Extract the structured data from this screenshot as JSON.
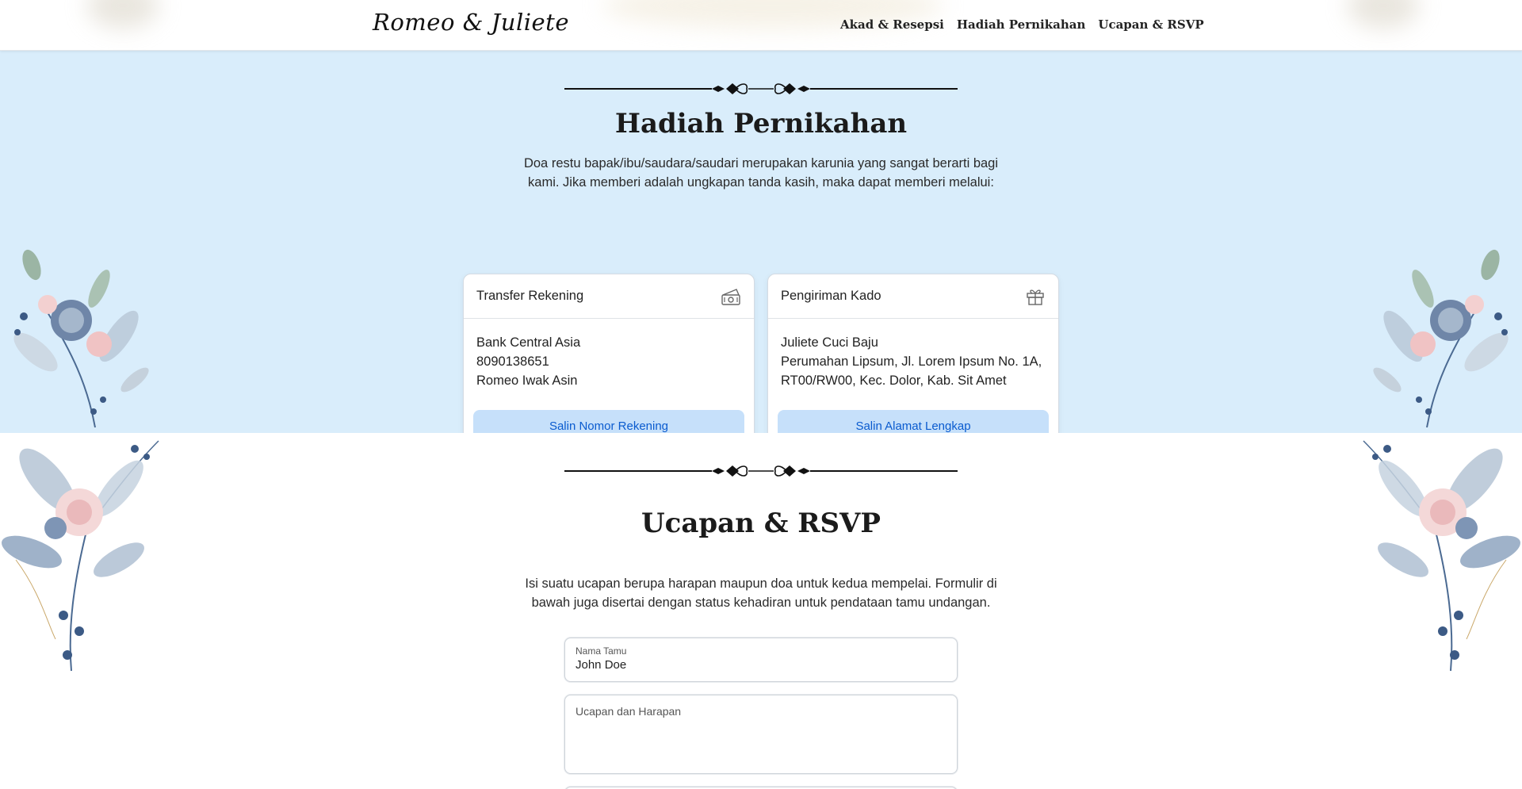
{
  "navbar": {
    "brand": "Romeo & Juliete",
    "links": [
      "Akad & Resepsi",
      "Hadiah Pernikahan",
      "Ucapan & RSVP"
    ]
  },
  "gift": {
    "title": "Hadiah Pernikahan",
    "description": "Doa restu bapak/ibu/saudara/saudari merupakan karunia yang sangat berarti bagi kami. Jika memberi adalah ungkapan tanda kasih, maka dapat memberi melalui:",
    "transfer": {
      "title": "Transfer Rekening",
      "icon": "money-icon",
      "bank": "Bank Central Asia",
      "account_number": "8090138651",
      "account_name": "Romeo Iwak Asin",
      "button": "Salin Nomor Rekening"
    },
    "shipping": {
      "title": "Pengiriman Kado",
      "icon": "gift-icon",
      "recipient": "Juliete Cuci Baju",
      "address": "Perumahan Lipsum, Jl. Lorem Ipsum No. 1A, RT00/RW00, Kec. Dolor, Kab. Sit Amet",
      "button": "Salin Alamat Lengkap"
    }
  },
  "rsvp": {
    "title": "Ucapan & RSVP",
    "description": "Isi suatu ucapan berupa harapan maupun doa untuk kedua mempelai. Formulir di bawah juga disertai dengan status kehadiran untuk pendataan tamu undangan.",
    "name_label": "Nama Tamu",
    "name_value": "John Doe",
    "message_label": "Ucapan dan Harapan"
  },
  "colors": {
    "gift_bg": "#d9edfb",
    "button_bg": "#c6e0fa",
    "button_text": "#0a5bcf"
  }
}
